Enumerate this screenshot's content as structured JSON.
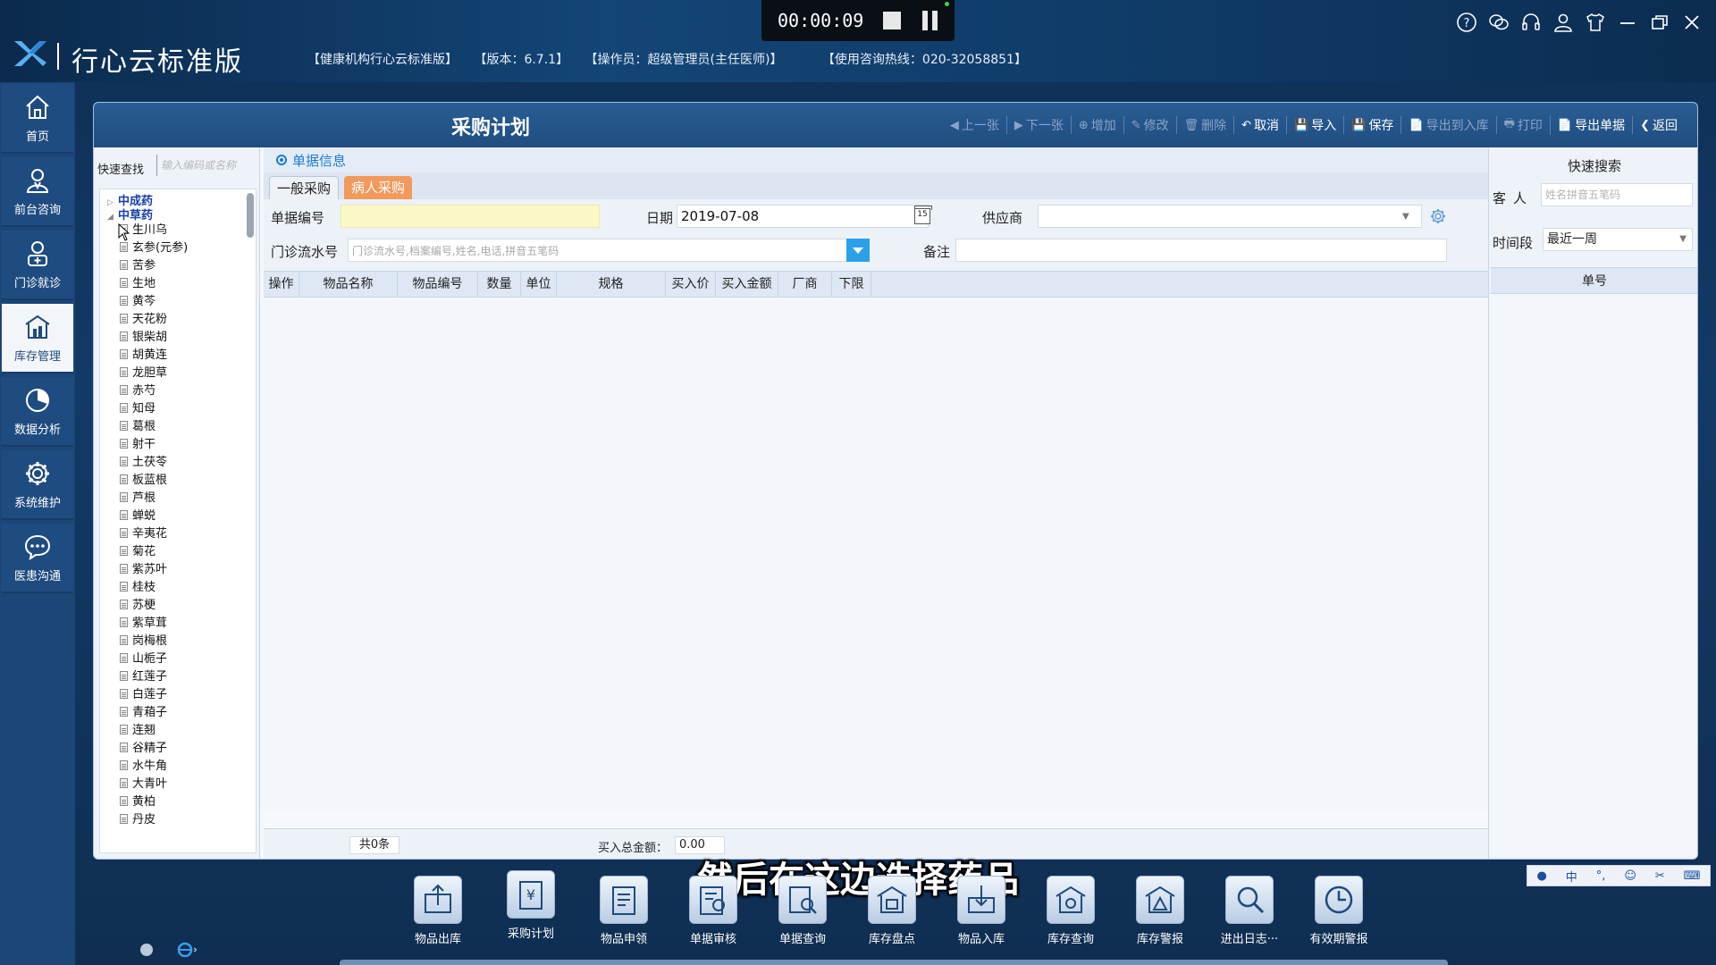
{
  "header": {
    "app_name": "行心云标准版",
    "org": "【健康机构行心云标准版】",
    "version": "【版本：6.7.1】",
    "operator": "【操作员：超级管理员(主任医师)】",
    "hotline": "【使用咨询热线：020-32058851】"
  },
  "recorder": {
    "time": "00:00:09"
  },
  "window_icons": [
    "help-icon",
    "wechat-icon",
    "headset-icon",
    "user-icon",
    "shirt-icon",
    "minimize-icon",
    "restore-icon",
    "close-icon"
  ],
  "nav": [
    {
      "label": "首页",
      "icon": "home-icon"
    },
    {
      "label": "前台咨询",
      "icon": "consult-icon"
    },
    {
      "label": "门诊就诊",
      "icon": "doctor-icon"
    },
    {
      "label": "库存管理",
      "icon": "warehouse-icon",
      "active": true
    },
    {
      "label": "数据分析",
      "icon": "chart-icon"
    },
    {
      "label": "系统维护",
      "icon": "gear-icon"
    },
    {
      "label": "医患沟通",
      "icon": "chat-icon"
    }
  ],
  "panel": {
    "title": "采购计划",
    "toolbar": [
      {
        "label": "上一张",
        "enabled": false,
        "icon": "◀"
      },
      {
        "label": "下一张",
        "enabled": false,
        "icon": "▶"
      },
      {
        "label": "增加",
        "enabled": false,
        "icon": "⊕"
      },
      {
        "label": "修改",
        "enabled": false,
        "icon": "✎"
      },
      {
        "label": "删除",
        "enabled": false,
        "icon": "🗑"
      },
      {
        "label": "取消",
        "enabled": true,
        "icon": "↶"
      },
      {
        "label": "导入",
        "enabled": true,
        "icon": "💾"
      },
      {
        "label": "保存",
        "enabled": true,
        "icon": "💾"
      },
      {
        "label": "导出到入库",
        "enabled": false,
        "icon": "📄"
      },
      {
        "label": "打印",
        "enabled": false,
        "icon": "🖶"
      },
      {
        "label": "导出单据",
        "enabled": true,
        "icon": "📄"
      },
      {
        "label": "返回",
        "enabled": true,
        "icon": "❮"
      }
    ]
  },
  "tree": {
    "quick_search_label": "快速查找",
    "quick_search_placeholder": "输入编码或名称",
    "roots": [
      "中成药",
      "中草药"
    ],
    "leaves": [
      "生川乌",
      "玄参(元参)",
      "苦参",
      "生地",
      "黄芩",
      "天花粉",
      "银柴胡",
      "胡黄连",
      "龙胆草",
      "赤芍",
      "知母",
      "葛根",
      "射干",
      "土茯苓",
      "板蓝根",
      "芦根",
      "蝉蜕",
      "辛夷花",
      "菊花",
      "紫苏叶",
      "桂枝",
      "苏梗",
      "紫草茸",
      "岗梅根",
      "山栀子",
      "红莲子",
      "白莲子",
      "青葙子",
      "连翘",
      "谷精子",
      "水牛角",
      "大青叶",
      "黄柏",
      "丹皮"
    ]
  },
  "form": {
    "section_title": "单据信息",
    "tabs": [
      "一般采购",
      "病人采购"
    ],
    "bill_no_label": "单据编号",
    "bill_no_value": "",
    "date_label": "日期",
    "date_value": "2019-07-08",
    "date_icon_text": "15",
    "supplier_label": "供应商",
    "supplier_value": "",
    "visit_label": "门诊流水号",
    "visit_placeholder": "门诊流水号,档案编号,姓名,电话,拼音五笔码",
    "remark_label": "备注",
    "remark_value": ""
  },
  "grid": {
    "columns": [
      "操作",
      "物品名称",
      "物品编号",
      "数量",
      "单位",
      "规格",
      "买入价",
      "买入金额",
      "厂商",
      "下限"
    ],
    "rows": [],
    "count": "共0条",
    "total_label": "买入总金额：",
    "total_value": "0.00"
  },
  "quick_search": {
    "title": "快速搜索",
    "client_label": "客人",
    "client_placeholder": "姓名拼音五笔码",
    "period_label": "时间段",
    "period_value": "最近一周",
    "column": "单号"
  },
  "dock": [
    {
      "label": "物品出库",
      "icon": "outbound-icon"
    },
    {
      "label": "采购计划",
      "icon": "purchase-plan-icon"
    },
    {
      "label": "物品申领",
      "icon": "requisition-icon"
    },
    {
      "label": "单据审核",
      "icon": "audit-icon"
    },
    {
      "label": "单据查询",
      "icon": "bill-search-icon"
    },
    {
      "label": "库存盘点",
      "icon": "stocktake-icon"
    },
    {
      "label": "物品入库",
      "icon": "inbound-icon"
    },
    {
      "label": "库存查询",
      "icon": "stock-search-icon"
    },
    {
      "label": "库存警报",
      "icon": "stock-alert-icon"
    },
    {
      "label": "进出日志···",
      "icon": "log-icon"
    },
    {
      "label": "有效期警报",
      "icon": "expiry-icon"
    }
  ],
  "subtitle": "然后在这边选择药品",
  "ime": [
    "中",
    "°,",
    "☺",
    "✂",
    "⌨"
  ],
  "colors": {
    "accent": "#1f7ad0",
    "tab_active": "#f19a5b",
    "panel_header": "#1f4d80",
    "nav_bg": "#1c4676"
  }
}
